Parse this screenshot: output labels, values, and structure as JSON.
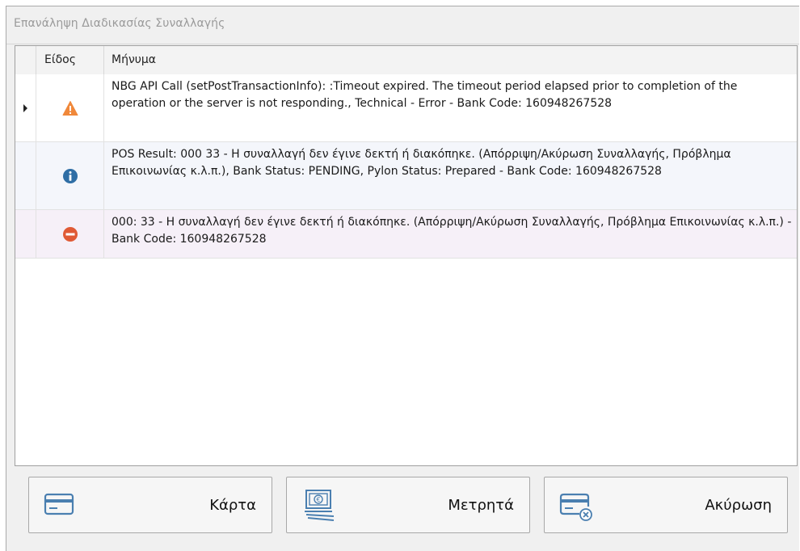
{
  "window": {
    "title": "Επανάληψη Διαδικασίας Συναλλαγής"
  },
  "grid": {
    "columns": {
      "type": "Είδος",
      "message": "Μήνυμα"
    },
    "rows": [
      {
        "type_icon": "warning-icon",
        "selected": true,
        "message": "NBG API Call (setPostTransactionInfo): :Timeout expired.  The timeout period elapsed prior to completion of the operation or the server is not responding., Technical - Error - Bank Code: 160948267528"
      },
      {
        "type_icon": "info-icon",
        "selected": false,
        "message": "POS Result: 000 33 - Η συναλλαγή δεν έγινε δεκτή ή διακόπηκε. (Απόρριψη/Ακύρωση Συναλλαγής, Πρόβλημα Επικοινωνίας κ.λ.π.), Bank Status: PENDING, Pylon Status: Prepared - Bank Code: 160948267528"
      },
      {
        "type_icon": "error-icon",
        "selected": false,
        "message": "000: 33 - Η συναλλαγή δεν έγινε δεκτή ή διακόπηκε. (Απόρριψη/Ακύρωση Συναλλαγής, Πρόβλημα Επικοινωνίας κ.λ.π.) - Bank Code: 160948267528"
      }
    ]
  },
  "buttons": {
    "card": {
      "label": "Κάρτα",
      "icon": "credit-card-icon"
    },
    "cash": {
      "label": "Μετρητά",
      "icon": "cash-euro-icon"
    },
    "cancel": {
      "label": "Ακύρωση",
      "icon": "card-cancel-icon"
    }
  },
  "colors": {
    "warning": "#f0883a",
    "info": "#2f6ea5",
    "error": "#e05a35",
    "icon_blue": "#4a7fb0",
    "row_alt": "#f4f6fb",
    "row_error": "#f6f0f8"
  }
}
